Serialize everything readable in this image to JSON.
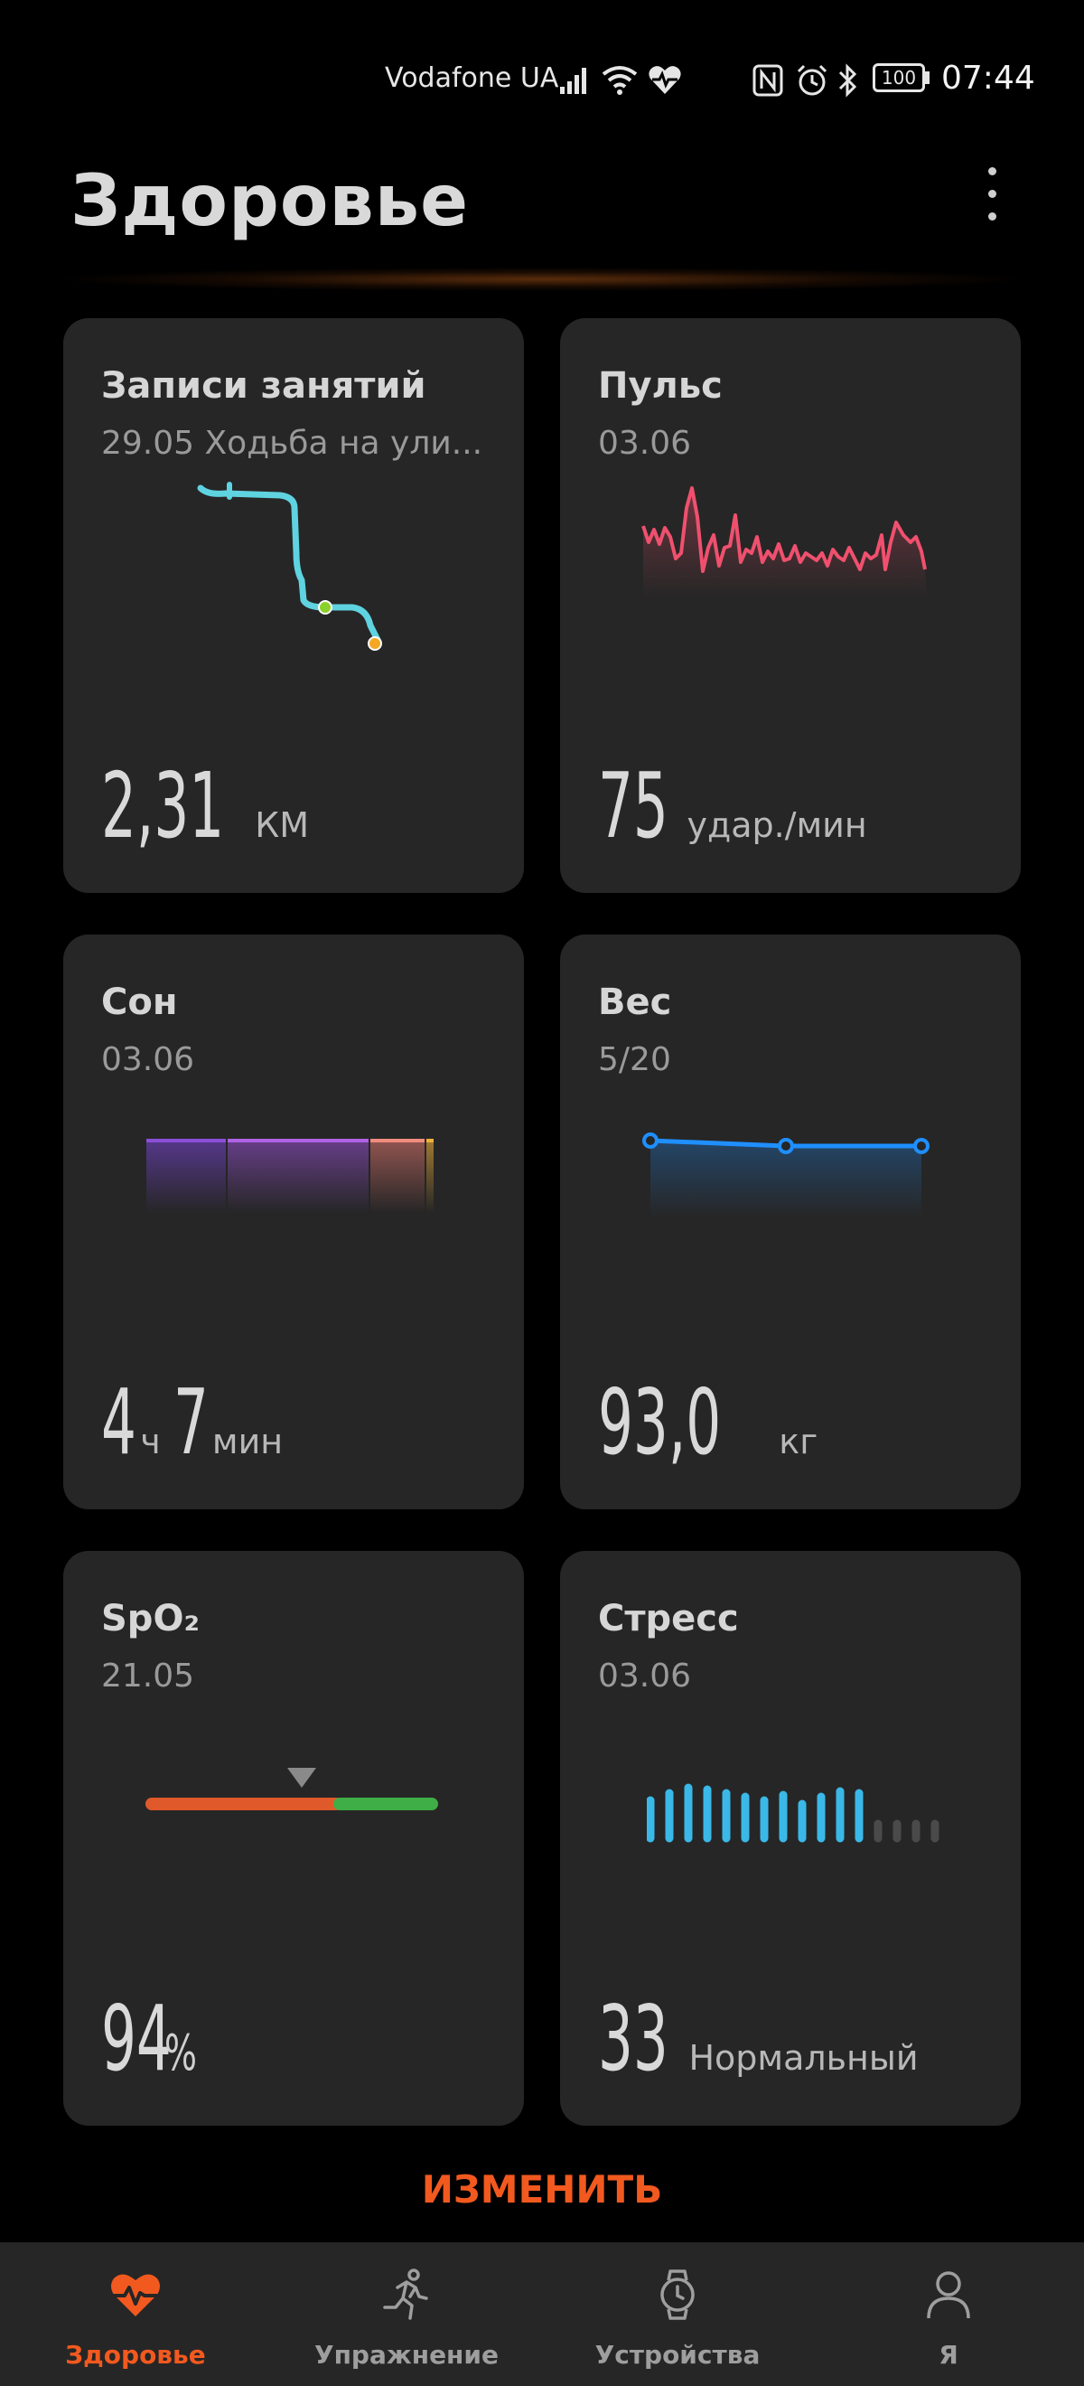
{
  "status_bar": {
    "carrier": "Vodafone UA",
    "battery": "100",
    "time": "07:44",
    "icons": [
      "signal-icon",
      "wifi-icon",
      "health-heart-icon",
      "nfc-icon",
      "alarm-icon",
      "bluetooth-icon",
      "battery-icon"
    ]
  },
  "header": {
    "title": "Здоровье",
    "more_icon": "more-vertical-icon"
  },
  "cards": {
    "activity": {
      "title": "Записи занятий",
      "subtitle": "29.05 Ходьба на ули...",
      "value": "2,31",
      "unit": "КМ",
      "route_color": "#5fd3e0"
    },
    "pulse": {
      "title": "Пульс",
      "subtitle": "03.06",
      "value": "75",
      "unit": "удар./мин",
      "line_color": "#f0506e"
    },
    "sleep": {
      "title": "Сон",
      "subtitle": "03.06",
      "hours": "4",
      "hours_unit": "ч",
      "minutes": "7",
      "minutes_unit": "мин"
    },
    "weight": {
      "title": "Вес",
      "subtitle": "5/20",
      "value": "93,0",
      "unit": "кг",
      "line_color": "#1f8fff"
    },
    "spo2": {
      "title": "SpO₂",
      "subtitle": "21.05",
      "value": "94",
      "unit": "%",
      "low_color": "#e0592a",
      "normal_color": "#3fae46"
    },
    "stress": {
      "title": "Стресс",
      "subtitle": "03.06",
      "value": "33",
      "level": "Нормальный",
      "bar_color": "#3ab8e8"
    }
  },
  "edit_button": {
    "label": "ИЗМЕНИТЬ"
  },
  "bottom_nav": {
    "items": [
      {
        "label": "Здоровье",
        "icon": "heart-pulse-icon",
        "active": true
      },
      {
        "label": "Упражнение",
        "icon": "running-icon",
        "active": false
      },
      {
        "label": "Устройства",
        "icon": "watch-icon",
        "active": false
      },
      {
        "label": "Я",
        "icon": "person-icon",
        "active": false
      }
    ]
  },
  "accent_color": "#f2591f"
}
